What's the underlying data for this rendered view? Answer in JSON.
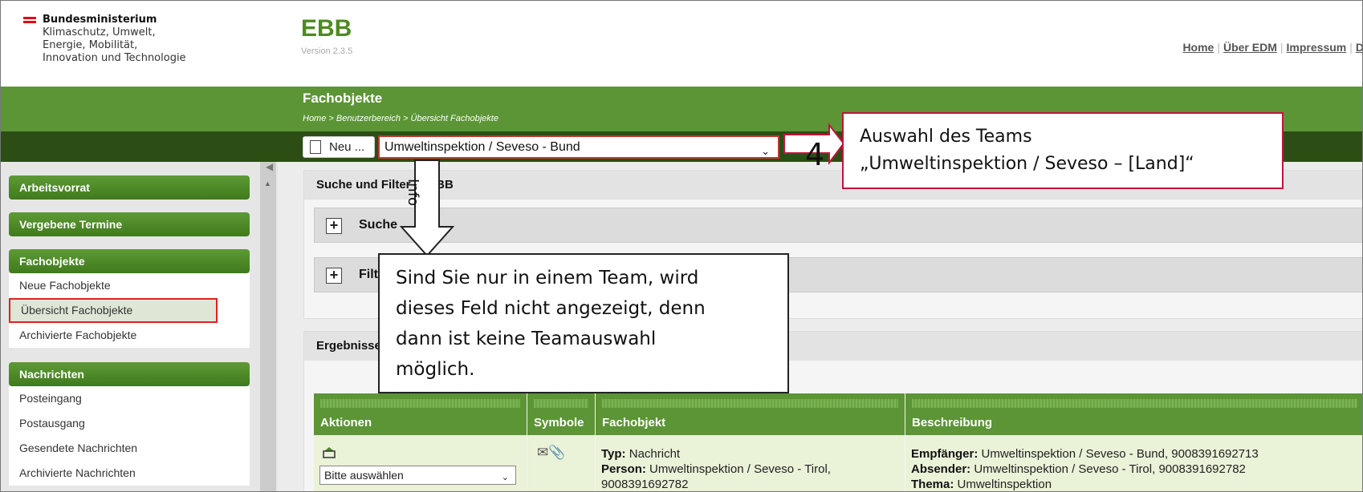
{
  "header": {
    "logo_lines": [
      "Bundesministerium",
      "Klimaschutz, Umwelt,",
      "Energie, Mobilität,",
      "Innovation und Technologie"
    ],
    "app_title": "EBB",
    "app_version": "Version 2.3.5",
    "top_links": [
      "Home",
      "Über EDM",
      "Impressum",
      "D"
    ]
  },
  "titlebar": {
    "title": "Fachobjekte",
    "breadcrumb": "Home > Benutzerbereich > Übersicht Fachobjekte"
  },
  "toolbar": {
    "new_label": "Neu ...",
    "team_select": "Umweltinspektion / Seveso - Bund"
  },
  "sidebar": {
    "sections": [
      {
        "title": "Arbeitsvorrat",
        "items": []
      },
      {
        "title": "Vergebene Termine",
        "items": []
      },
      {
        "title": "Fachobjekte",
        "items": [
          "Neue Fachobjekte",
          "Übersicht Fachobjekte",
          "Archivierte Fachobjekte"
        ]
      },
      {
        "title": "Nachrichten",
        "items": [
          "Posteingang",
          "Postausgang",
          "Gesendete Nachrichten",
          "Archivierte Nachrichten"
        ]
      }
    ],
    "active_item": "Übersicht Fachobjekte"
  },
  "main": {
    "search_panel_title": "Suche und Filter in EBB",
    "search_fold": "Suche",
    "filter_fold": "Filter",
    "results_title": "Ergebnisse",
    "table": {
      "columns": [
        "Aktionen",
        "Symbole",
        "Fachobjekt",
        "Beschreibung"
      ],
      "row": {
        "action_select": "Bitte auswählen",
        "fachobjekt": {
          "typ_label": "Typ:",
          "typ": "Nachricht",
          "person_label": "Person:",
          "person": "Umweltinspektion / Seveso - Tirol,",
          "person_id": "9008391692782"
        },
        "beschreibung": {
          "empf_label": "Empfänger:",
          "empf": "Umweltinspektion / Seveso - Bund, 9008391692713",
          "abs_label": "Absender:",
          "abs": "Umweltinspektion / Seveso - Tirol, 9008391692782",
          "thema_label": "Thema:",
          "thema": "Umweltinspektion"
        }
      }
    }
  },
  "annotations": {
    "step_number": "4",
    "team_callout_line1": "Auswahl des Teams",
    "team_callout_line2": "„Umweltinspektion / Seveso – [Land]“",
    "info_label": "Info",
    "info_callout_lines": [
      "Sind Sie nur in einem Team, wird",
      "dieses Feld nicht angezeigt, denn",
      "dann ist keine Teamauswahl",
      "möglich."
    ]
  },
  "colors": {
    "brand_green": "#5b9535",
    "dark_green": "#2c4e15",
    "highlight_red": "#e02020",
    "callout_border": "#c0143c"
  }
}
